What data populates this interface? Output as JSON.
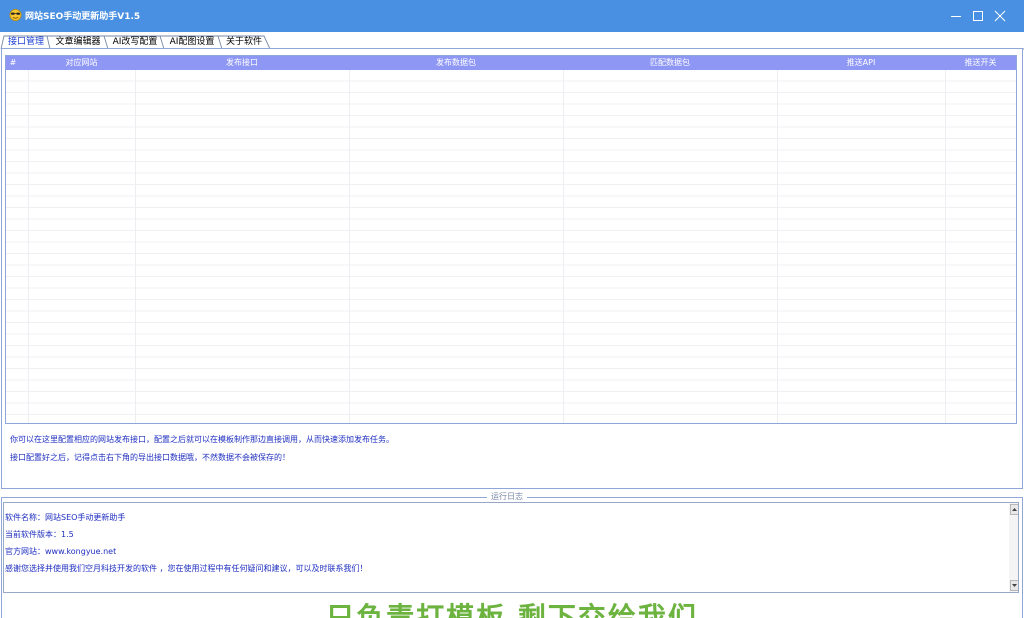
{
  "window": {
    "title": "网站SEO手动更新助手V1.5"
  },
  "tabs": [
    {
      "label": "接口管理",
      "active": true
    },
    {
      "label": "文章编辑器"
    },
    {
      "label": "AI改写配置"
    },
    {
      "label": "AI配图设置"
    },
    {
      "label": "关于软件"
    }
  ],
  "grid": {
    "columns": [
      "#",
      "对应网站",
      "发布接口",
      "发布数据包",
      "匹配数据包",
      "推送API",
      "推送开关"
    ],
    "header_color": "#8f97f5"
  },
  "hints": [
    "你可以在这里配置相应的网站发布接口，配置之后就可以在模板制作那边直接调用，从而快速添加发布任务。",
    "接口配置好之后，记得点击右下角的导出接口数据哦，不然数据不会被保存的！"
  ],
  "log": {
    "legend": "运行日志",
    "lines": [
      "软件名称：网站SEO手动更新助手",
      "当前软件版本：1.5",
      "官方网站：www.kongyue.net",
      "感谢您选择并使用我们空月科技开发的软件 ，您在使用过程中有任何疑问和建议，可以及时联系我们！"
    ]
  },
  "banner": {
    "text": "只负责打模板 剩下交给我们"
  },
  "icons": {
    "app": "sunglasses-smiley-icon",
    "minimize": "minimize-icon",
    "maximize": "maximize-icon",
    "close": "close-icon",
    "scroll_up": "chevron-up-icon",
    "scroll_down": "chevron-down-icon"
  },
  "colors": {
    "titlebar": "#4a90e2",
    "hint_text": "#1f2fc0",
    "banner_text": "#6db33f"
  }
}
